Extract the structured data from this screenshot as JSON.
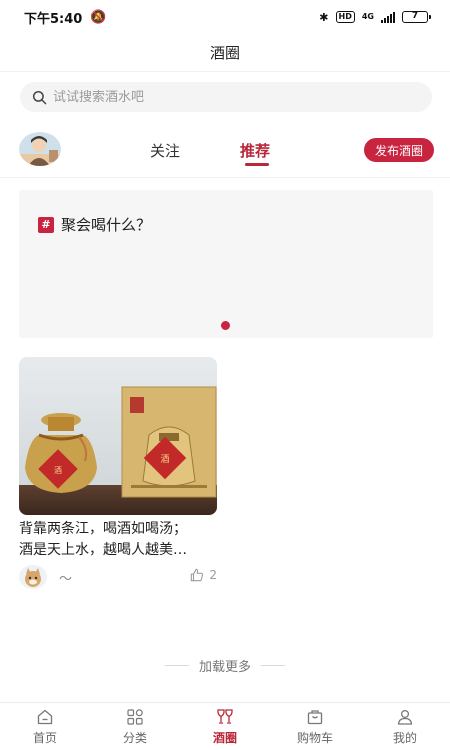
{
  "status_bar": {
    "time": "下午5:40",
    "mute_glyph": "🔕",
    "bluetooth": "✱",
    "hd": "HD",
    "network": "4G",
    "battery": "7"
  },
  "title": "酒圈",
  "search": {
    "placeholder": "试试搜索酒水吧",
    "icon": "search-icon"
  },
  "feed_tabs": [
    {
      "label": "关注",
      "active": false
    },
    {
      "label": "推荐",
      "active": true
    }
  ],
  "publish_button": "发布酒圈",
  "banner": {
    "tag_icon": "#",
    "topic": "聚会喝什么？",
    "page_indicator_count": 1
  },
  "posts": [
    {
      "text_lines": [
        "背靠两条江，喝酒如喝汤；",
        "酒是天上水，越喝人越美…"
      ],
      "nickname": "～",
      "likes": "2"
    }
  ],
  "load_more": "加载更多",
  "bottom_tabs": [
    {
      "label": "首页",
      "icon": "home-icon"
    },
    {
      "label": "分类",
      "icon": "category-icon"
    },
    {
      "label": "酒圈",
      "icon": "wine-glasses-icon",
      "active": true
    },
    {
      "label": "购物车",
      "icon": "cart-icon"
    },
    {
      "label": "我的",
      "icon": "profile-icon"
    }
  ],
  "colors": {
    "accent": "#c8233f",
    "accent_text": "#b8283a"
  }
}
